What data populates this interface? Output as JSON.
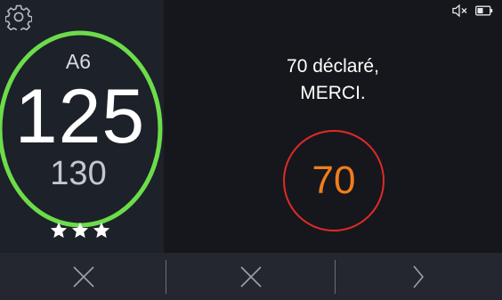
{
  "speed": {
    "road": "A6",
    "current": "125",
    "limit": "130",
    "stars": 3
  },
  "message": {
    "line1": "70 déclaré,",
    "line2": "MERCI."
  },
  "declared_limit": "70",
  "colors": {
    "ring": "#6cdc4a",
    "sign_border": "#e02a27",
    "sign_value": "#f07e1c"
  },
  "icons": {
    "settings": "gear-icon",
    "mute": "speaker-muted-icon",
    "battery": "battery-icon",
    "dismiss_left": "close-icon",
    "dismiss_mid": "close-icon",
    "next": "chevron-right-icon"
  }
}
